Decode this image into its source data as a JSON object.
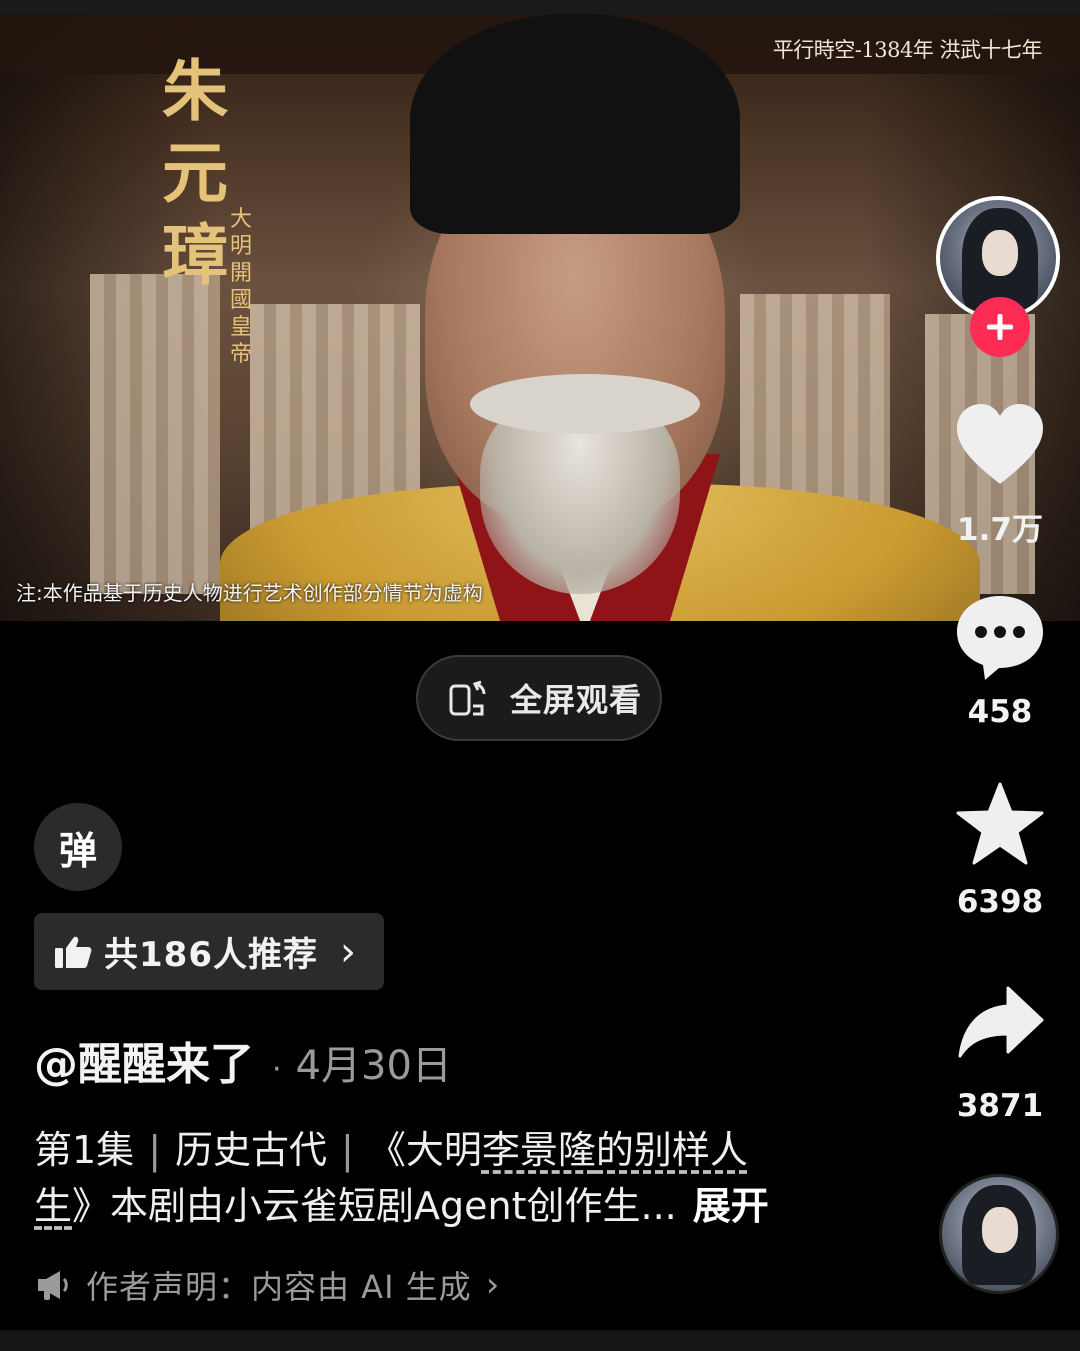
{
  "video": {
    "title_name": "朱元璋",
    "title_sub": "大明開國皇帝",
    "corner_caption": "平行時空-1384年 洪武十七年",
    "disclaimer": "注:本作品基于历史人物进行艺术创作部分情节为虚构"
  },
  "fullscreen": {
    "label": "全屏观看",
    "icon": "rotate-phone-icon"
  },
  "rail": {
    "follow_icon": "plus-icon",
    "like_count": "1.7万",
    "comment_count": "458",
    "favorite_count": "6398",
    "share_count": "3871",
    "accent": "#fe2c55"
  },
  "danmu": {
    "label": "弹"
  },
  "recommend": {
    "label": "共186人推荐",
    "icon": "thumbs-up-icon",
    "arrow": "›"
  },
  "post": {
    "author": "@醒醒来了",
    "separator": "·",
    "date": "4月30日",
    "episode": "第1集",
    "category": "历史古代",
    "sep1": "|",
    "sep2": "|",
    "title_open": "《大明",
    "title_link1": "李景隆",
    "title_mid": "的别样人",
    "title_link2": "生",
    "title_close": "》本剧由小云雀短剧Agent创作生...",
    "expand": "展开"
  },
  "statement": {
    "label": "作者声明：内容由 AI 生成",
    "icon": "megaphone-icon"
  }
}
